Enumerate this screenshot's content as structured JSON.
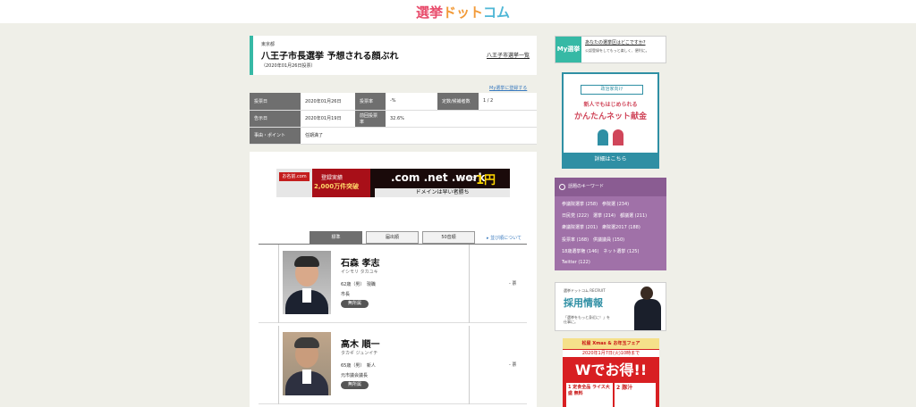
{
  "header": {
    "logo_part1": "選挙",
    "logo_part2": "ドット",
    "logo_part3": "コム"
  },
  "election": {
    "prefecture": "東京都",
    "title": "八王子市長選挙 予想される顔ぶれ",
    "date_note": "（2020年01月26日投票）",
    "list_link": "八王子市選挙一覧",
    "my_register": "My選挙に登録する"
  },
  "info": {
    "rows": [
      [
        {
          "k": "投票日",
          "v": "2020年01月26日"
        },
        {
          "k": "投票率",
          "v": "-%"
        },
        {
          "k": "定数/候補者数",
          "v": "1 / 2"
        }
      ],
      [
        {
          "k": "告示日",
          "v": "2020年01月19日"
        },
        {
          "k": "前回投票率",
          "v": "32.6%"
        }
      ],
      [
        {
          "k": "事由・ポイント",
          "v": "任期満了"
        }
      ]
    ]
  },
  "ad_banner": {
    "tile": "お名前.com",
    "red_line1": "登録実績",
    "red_line2": "2,000万件突破",
    "main": ".com .net .work",
    "domain_word": "ドメイン",
    "price": "1円",
    "sub": "ドメインは早い者勝ち"
  },
  "tabs": {
    "items": [
      "標準",
      "届出順",
      "50音順"
    ],
    "about_order": "並び順について"
  },
  "candidates": [
    {
      "name": "石森 孝志",
      "kana": "イシモリ タカユキ",
      "age": "62歳（男）　現職",
      "position": "市長",
      "party": "無所属",
      "votes": "- 票"
    },
    {
      "name": "高木 順一",
      "kana": "タカギ ジュンイチ",
      "age": "65歳（男）　新人",
      "position": "元市議会議長",
      "party": "無所属",
      "votes": "- 票"
    }
  ],
  "sidebar": {
    "my_badge": "My選挙",
    "my_question": "あなたの選挙区はどこですか?",
    "my_desc": "公認登録をしてもっと楽しく、便利に。",
    "donate": {
      "header": "政治家向け",
      "line1": "新人でもはじめられる",
      "line2": "かんたんネット献金",
      "cta": "詳細はこちら"
    },
    "keywords_title": "話題のキーワード",
    "keyword_lines": [
      "参議院選挙 (258)　参院選 (234)",
      "日民党 (222)　選挙 (214)　都議選 (211)",
      "衆議院選挙 (201)　衆院選2017 (188)",
      "投票率 (168)　供議議員 (150)",
      "18歳選挙権 (146)　ネット選挙 (125)",
      "Twitter (122)"
    ],
    "recruit": {
      "small": "選挙ドットコム RECRUIT",
      "title": "採用情報",
      "desc": "「選挙をもっと身近に！」を仕事に。"
    },
    "fair": {
      "top": "松屋 Xmas & お年玉フェア",
      "date": "2020年1月7日(火)10時まで",
      "big": "Wでお得!!",
      "box1": "1 定食全品 ライス大盛 無料",
      "box2": "2 豚汁"
    }
  }
}
